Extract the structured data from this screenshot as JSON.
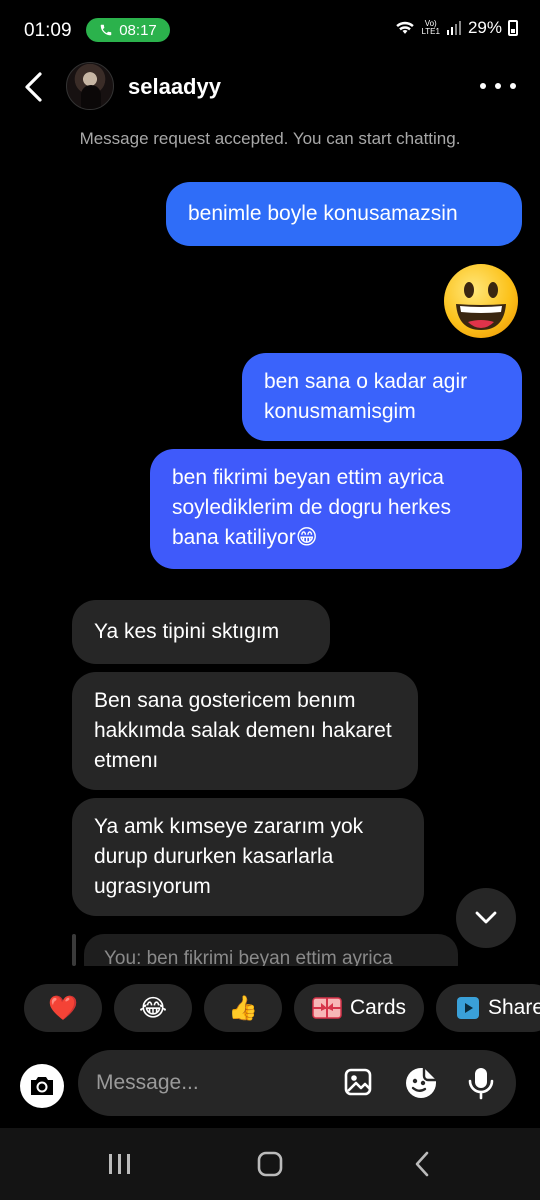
{
  "status_bar": {
    "time": "01:09",
    "call_time": "08:17",
    "network_top": "Vo)",
    "network_bottom": "LTE1",
    "battery": "29%"
  },
  "header": {
    "username": "selaadyy"
  },
  "notice": "Message request accepted. You can start chatting.",
  "messages": [
    {
      "side": "sent",
      "text": "benimle boyle konusamazsin"
    },
    {
      "side": "sent",
      "emoji": "grinning-face",
      "text": ""
    },
    {
      "side": "sent",
      "text": "ben sana o kadar agir konusmamisgim"
    },
    {
      "side": "sent",
      "text": "ben fikrimi beyan ettim ayrica soylediklerim de dogru herkes bana katiliyor😁"
    },
    {
      "side": "received",
      "text": "Ya kes tipini sktıgım"
    },
    {
      "side": "received",
      "text": "Ben sana gostericem benım hakkımda salak demenı hakaret etmenı"
    },
    {
      "side": "received",
      "text": "Ya amk kımseye zararım yok durup dururken kasarlarla ugrasıyorum"
    }
  ],
  "reply_preview": "You: ben fikrimi beyan ettim ayrica",
  "quick_replies": [
    {
      "icon": "heart-emoji",
      "glyph": "❤️"
    },
    {
      "icon": "laughing-tears-emoji",
      "glyph": "😂"
    },
    {
      "icon": "thumbs-up-emoji",
      "glyph": "👍"
    },
    {
      "icon": "gift-card-icon",
      "label": "Cards"
    },
    {
      "icon": "share-icon",
      "label": "Share"
    }
  ],
  "composer": {
    "placeholder": "Message..."
  },
  "colors": {
    "sent_bubble": "#3b5bfb",
    "received_bubble": "#262626",
    "background": "#000000",
    "call_pill": "#2bb24c"
  }
}
